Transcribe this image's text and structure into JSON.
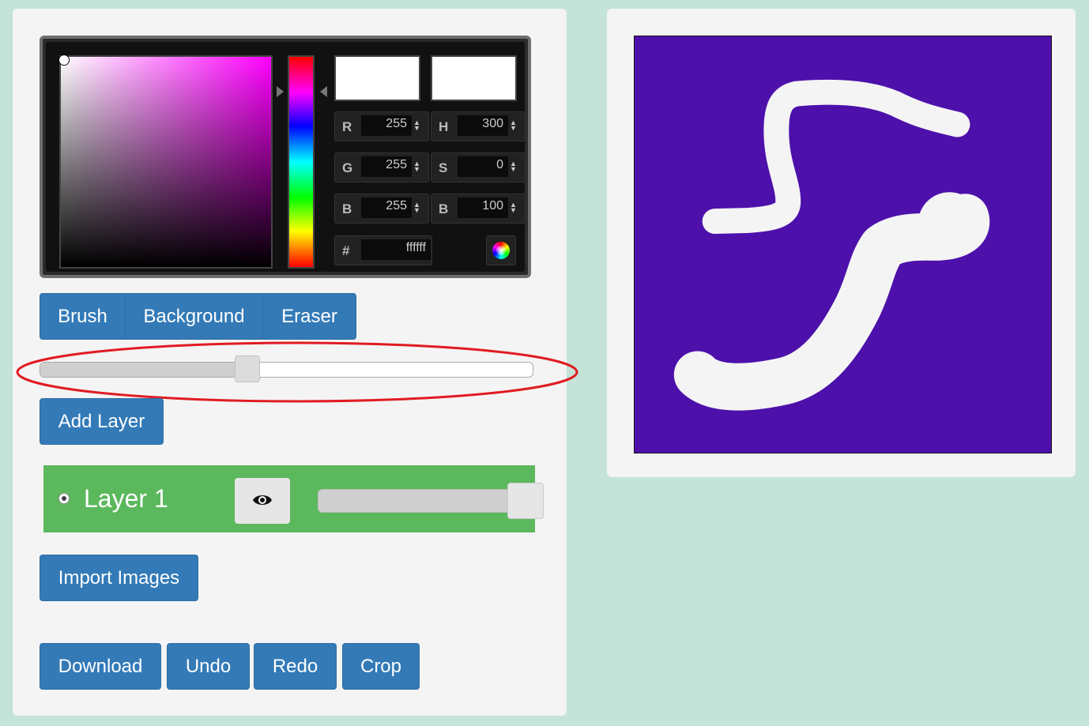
{
  "colors": {
    "page_bg": "#c4e3d9",
    "panel_bg": "#f4f4f4",
    "button_primary": "#337ab7",
    "layer_active": "#5cb85c",
    "canvas_bg": "#4d10ab",
    "stroke": "#f4f4f4",
    "highlight": "#e11b22"
  },
  "color_picker": {
    "hue_gradient": "red-magenta-blue-cyan-green-yellow-red",
    "new_color": "#ffffff",
    "current_color": "#ffffff",
    "fields": [
      {
        "key": "r",
        "label": "R",
        "value": "255"
      },
      {
        "key": "g",
        "label": "G",
        "value": "255"
      },
      {
        "key": "b",
        "label": "B",
        "value": "255"
      },
      {
        "key": "h",
        "label": "H",
        "value": "300"
      },
      {
        "key": "s",
        "label": "S",
        "value": "0"
      },
      {
        "key": "v",
        "label": "B",
        "value": "100"
      }
    ],
    "hex": {
      "label": "#",
      "value": "ffffff"
    },
    "wheel_icon": "color-wheel-icon"
  },
  "tools": {
    "brush_label": "Brush",
    "background_label": "Background",
    "eraser_label": "Eraser"
  },
  "brush_size": {
    "fraction": 0.42
  },
  "layers": {
    "add_label": "Add Layer",
    "items": [
      {
        "name": "Layer 1",
        "selected": true,
        "visible": true,
        "visibility_icon": "eye-icon",
        "opacity_fraction": 1.0
      }
    ]
  },
  "actions": {
    "import_label": "Import Images",
    "download_label": "Download",
    "undo_label": "Undo",
    "redo_label": "Redo",
    "crop_label": "Crop"
  }
}
